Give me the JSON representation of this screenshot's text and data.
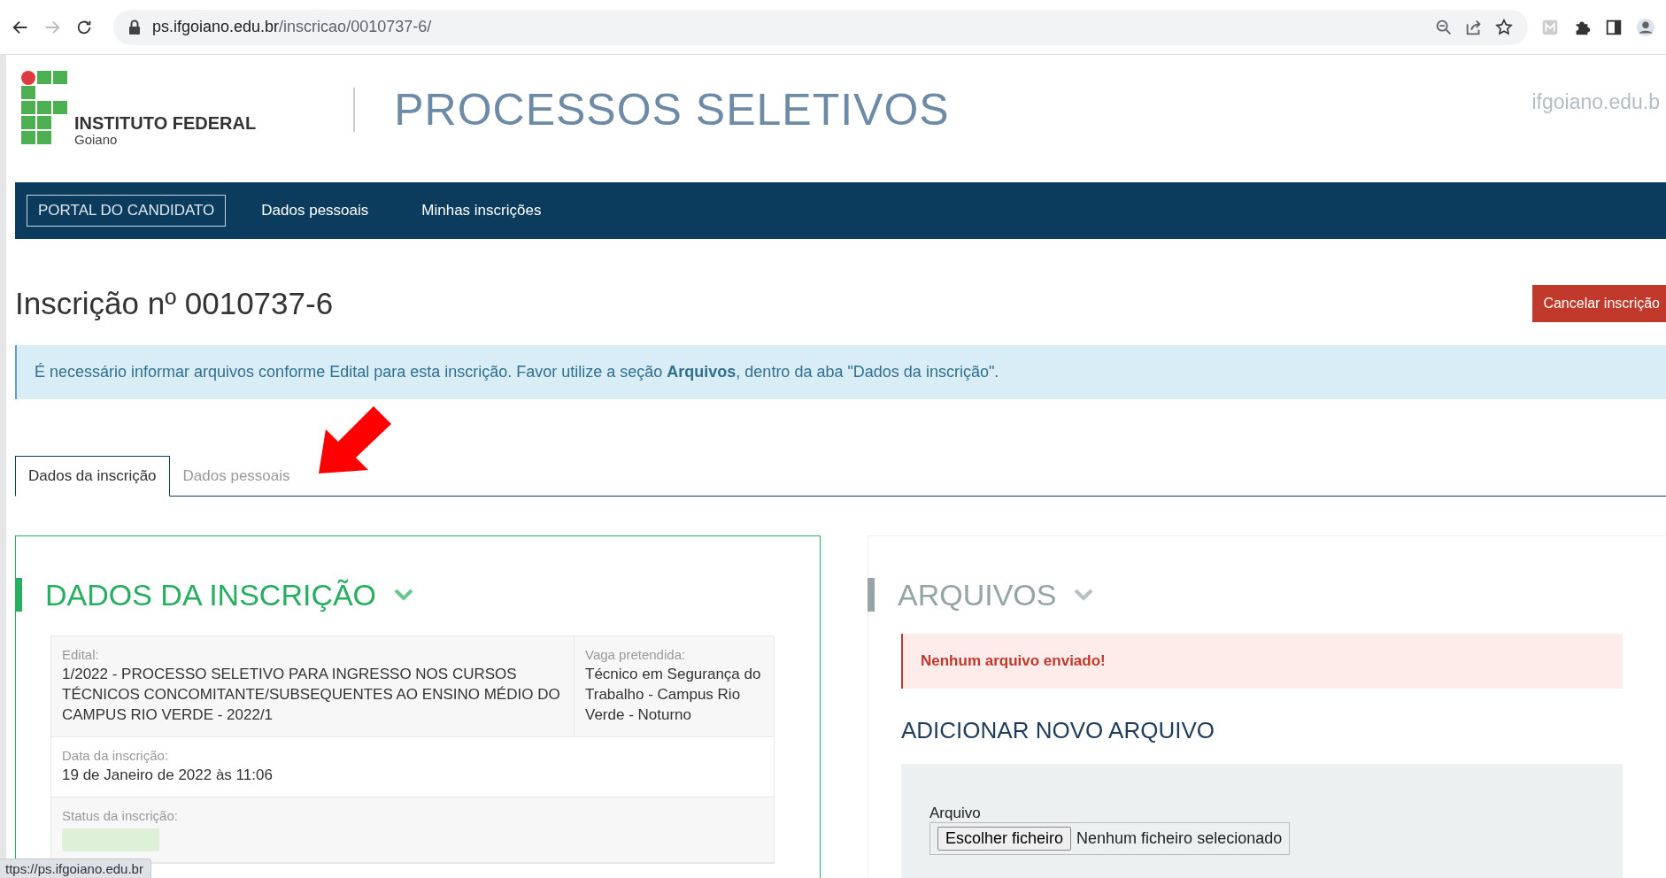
{
  "browser": {
    "url_host": "ps.ifgoiano.edu.br",
    "url_path": "/inscricao/0010737-6/",
    "forward_disabled": true
  },
  "header": {
    "logo_name": "INSTITUTO FEDERAL",
    "logo_sub": "Goiano",
    "title": "PROCESSOS SELETIVOS",
    "site_link": "ifgoiano.edu.b"
  },
  "nav": [
    {
      "label": "PORTAL DO CANDIDATO",
      "kind": "brand"
    },
    {
      "label": "Dados pessoais",
      "kind": "link"
    },
    {
      "label": "Minhas inscrições",
      "kind": "link"
    }
  ],
  "page_title": "Inscrição nº 0010737-6",
  "cancel_button": "Cancelar inscrição",
  "info_alert": "É necessário informar arquivos conforme Edital para esta inscrição. Favor utilize a seção **Arquivos**, dentro da aba \"Dados da inscrição\".",
  "tabs": [
    {
      "label": "Dados da inscrição",
      "selected": true
    },
    {
      "label": "Dados pessoais",
      "selected": false
    }
  ],
  "inscription_panel": {
    "title": "DADOS DA INSCRIÇÃO",
    "color": "#27ae60",
    "highlighted": true,
    "rows": [
      [
        {
          "label": "Edital:",
          "value": "1/2022 - PROCESSO SELETIVO PARA INGRESSO NOS CURSOS TÉCNICOS CONCOMITANTE/SUBSEQUENTES AO ENSINO MÉDIO DO CAMPUS RIO VERDE - 2022/1"
        },
        {
          "label": "Vaga pretendida:",
          "value": "Técnico em Segurança do Trabalho - Campus Rio Verde - Noturno"
        }
      ],
      [
        {
          "label": "Data da inscrição:",
          "value": "19 de Janeiro de 2022 às 11:06"
        }
      ],
      [
        {
          "label": "Status da inscrição:",
          "kind": "badge"
        }
      ]
    ]
  },
  "files_panel": {
    "title": "ARQUIVOS",
    "color": "#95a5a6",
    "highlighted": false,
    "error": "Nenhum arquivo enviado!",
    "subtitle": "ADICIONAR NOVO ARQUIVO",
    "field_label": "Arquivo",
    "choose_button": "Escolher ficheiro",
    "file_status": "Nenhum ficheiro selecionado"
  },
  "status_bar": "ttps://ps.ifgoiano.edu.br"
}
